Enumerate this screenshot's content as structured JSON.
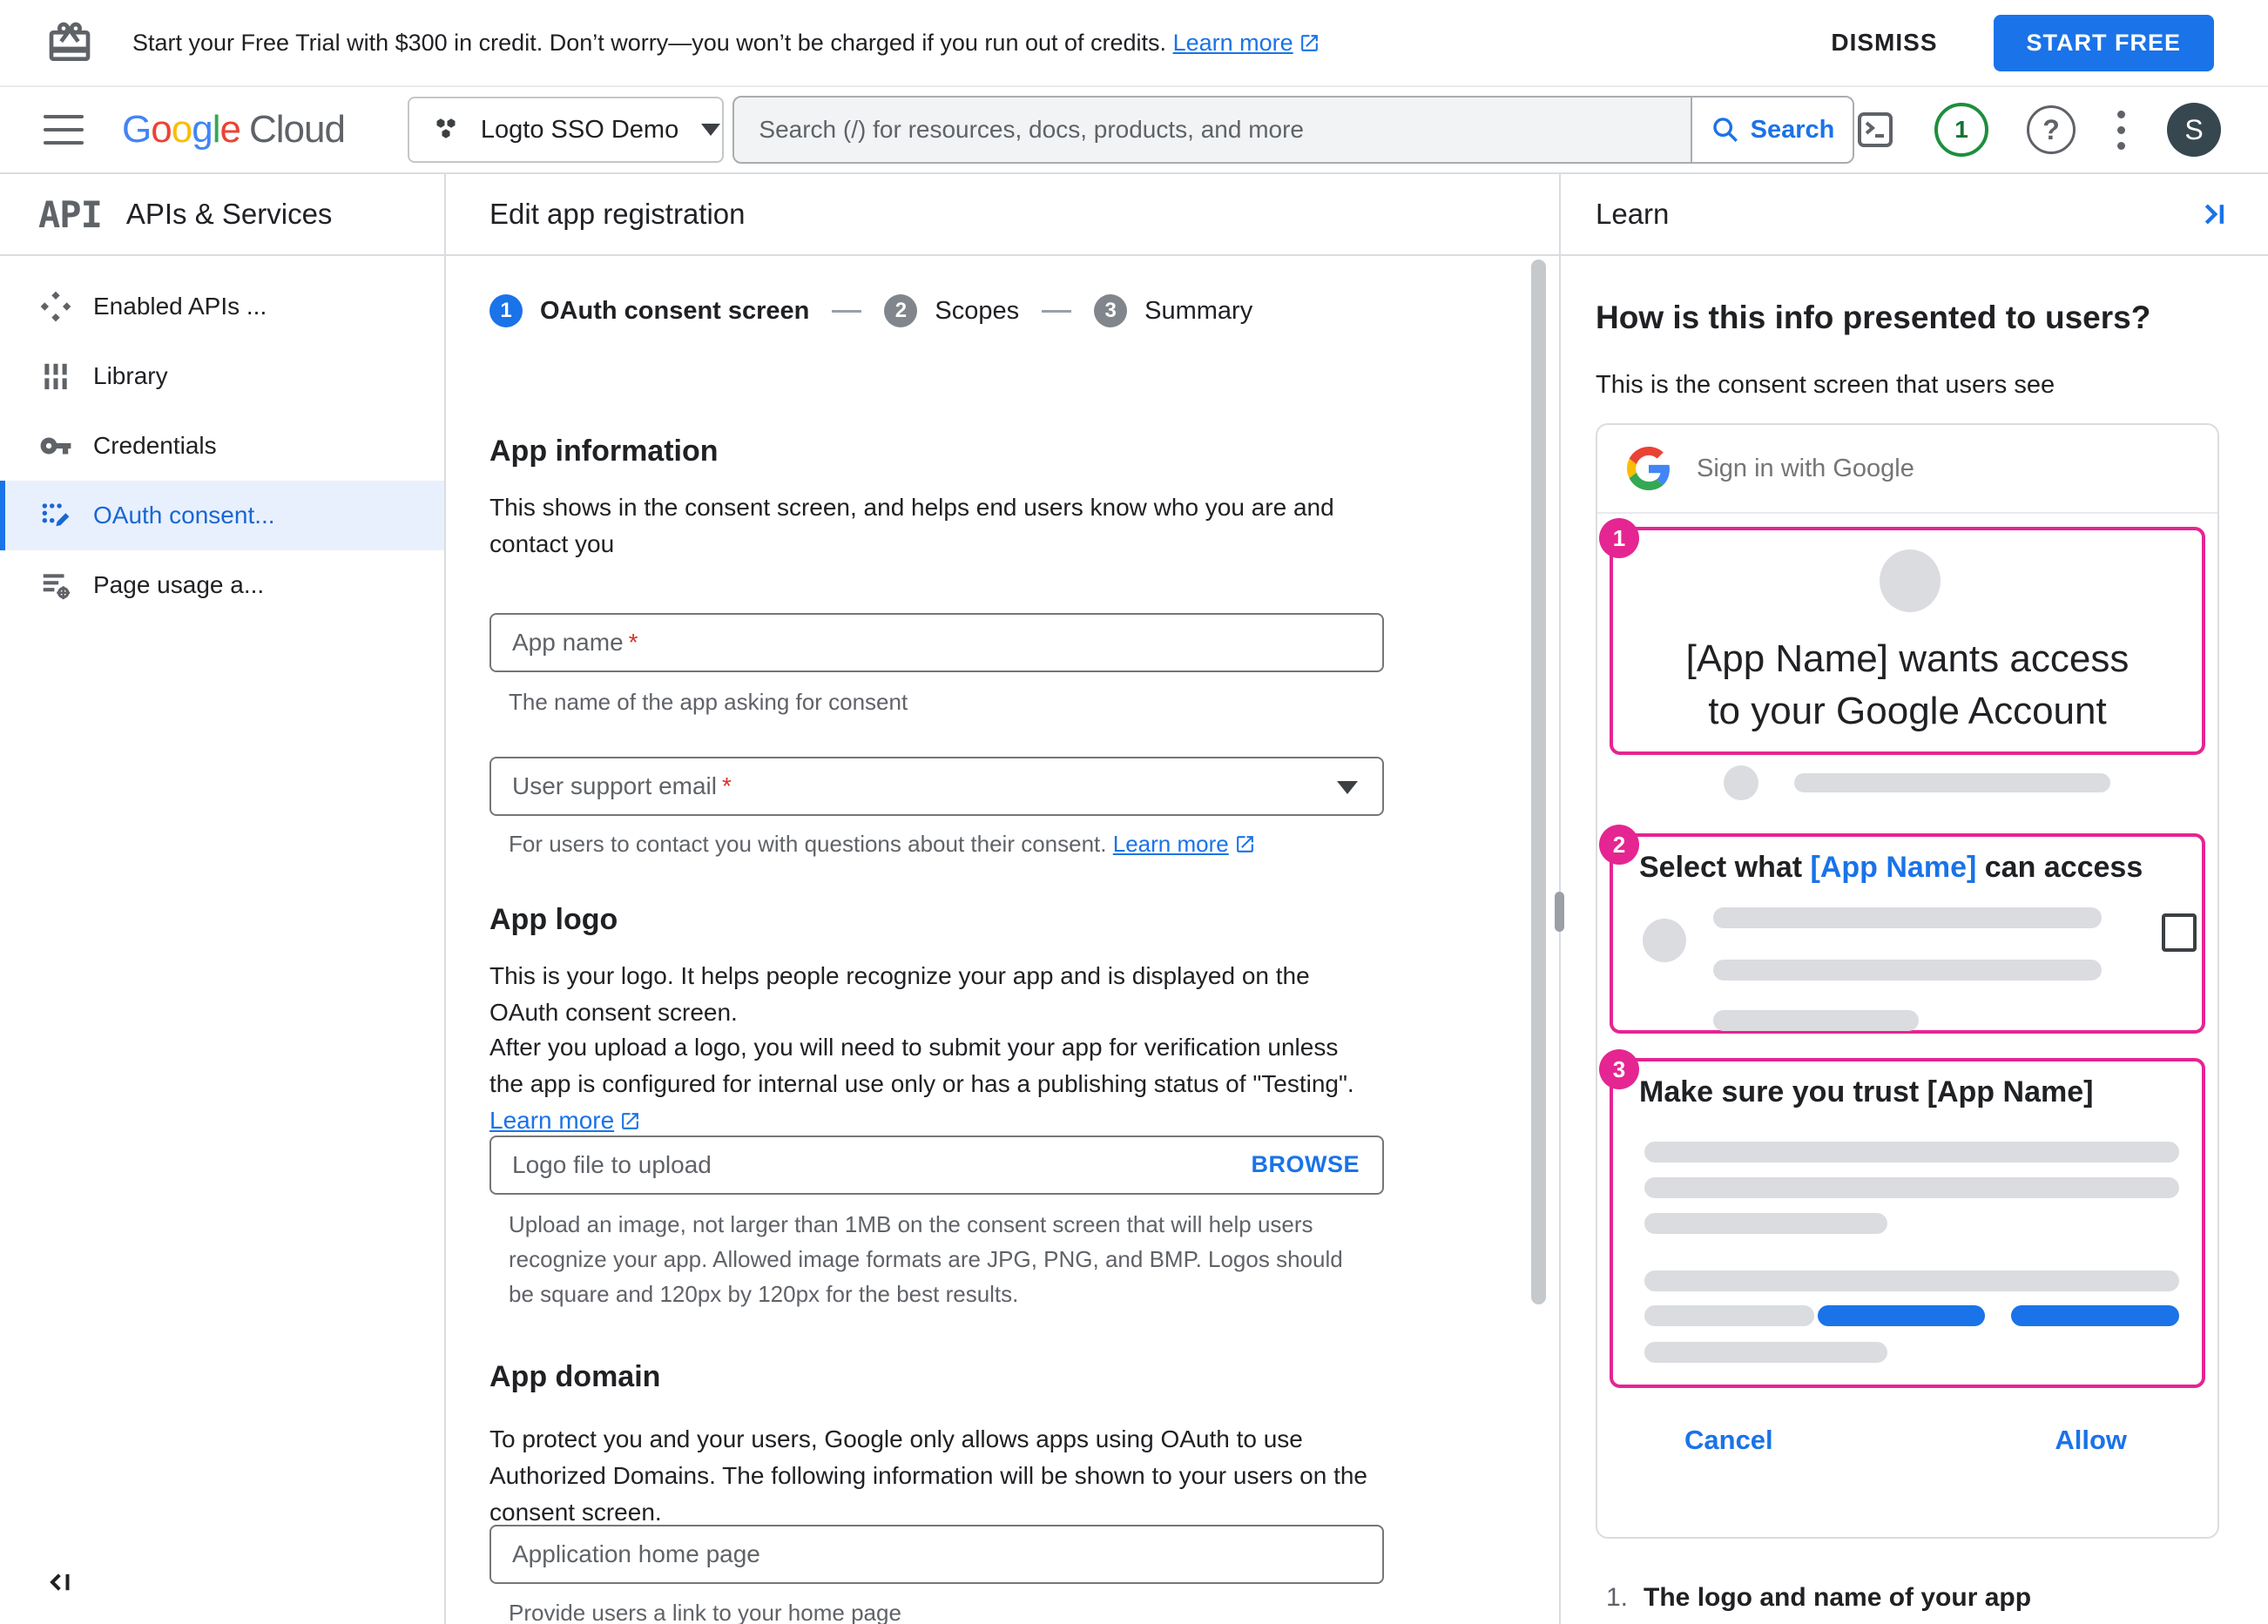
{
  "banner": {
    "message": "Start your Free Trial with $300 in credit. Don’t worry—you won’t be charged if you run out of credits.",
    "learn_more": "Learn more",
    "dismiss": "DISMISS",
    "start_free": "START FREE"
  },
  "header": {
    "logo_google": "Google",
    "logo_cloud": "Cloud",
    "project_name": "Logto SSO Demo",
    "search_placeholder": "Search (/) for resources, docs, products, and more",
    "search_button": "Search",
    "trial_days": "1",
    "avatar_initial": "S"
  },
  "sidebar": {
    "product_abbrev": "API",
    "title": "APIs & Services",
    "items": [
      {
        "label": "Enabled APIs ..."
      },
      {
        "label": "Library"
      },
      {
        "label": "Credentials"
      },
      {
        "label": "OAuth consent..."
      },
      {
        "label": "Page usage a..."
      }
    ]
  },
  "main": {
    "title": "Edit app registration",
    "stepper": [
      {
        "num": "1",
        "label": "OAuth consent screen"
      },
      {
        "num": "2",
        "label": "Scopes"
      },
      {
        "num": "3",
        "label": "Summary"
      }
    ],
    "app_information": {
      "heading": "App information",
      "description": "This shows in the consent screen, and helps end users know who you are and contact you",
      "app_name_label": "App name",
      "required_marker": "*",
      "app_name_helper": "The name of the app asking for consent",
      "email_label": "User support email",
      "email_helper": "For users to contact you with questions about their consent.",
      "email_learn_more": "Learn more"
    },
    "app_logo": {
      "heading": "App logo",
      "description_1": "This is your logo. It helps people recognize your app and is displayed on the OAuth consent screen.",
      "description_2": "After you upload a logo, you will need to submit your app for verification unless the app is configured for internal use only or has a publishing status of \"Testing\".",
      "learn_more": "Learn more",
      "upload_label": "Logo file to upload",
      "browse_button": "BROWSE",
      "upload_helper": "Upload an image, not larger than 1MB on the consent screen that will help users recognize your app. Allowed image formats are JPG, PNG, and BMP. Logos should be square and 120px by 120px for the best results."
    },
    "app_domain": {
      "heading": "App domain",
      "description": "To protect you and your users, Google only allows apps using OAuth to use Authorized Domains. The following information will be shown to your users on the consent screen.",
      "home_page_label": "Application home page",
      "home_page_helper": "Provide users a link to your home page"
    }
  },
  "learn": {
    "title": "Learn",
    "heading": "How is this info presented to users?",
    "subheading": "This is the consent screen that users see",
    "preview": {
      "signin_text": "Sign in with Google",
      "step1": {
        "badge": "1",
        "line1": "[App Name] wants access",
        "line2": "to your Google Account"
      },
      "step2": {
        "badge": "2",
        "title_pre": "Select what ",
        "title_app": "[App Name]",
        "title_post": " can access"
      },
      "step3": {
        "badge": "3",
        "title": "Make sure you trust [App Name]"
      },
      "cancel": "Cancel",
      "allow": "Allow"
    },
    "footnote": {
      "num": "1.",
      "text": "The logo and name of your app"
    }
  },
  "colors": {
    "accent_blue": "#1a73e8",
    "annotation_pink": "#e52592",
    "trial_green": "#1e8e3e",
    "google_letter_colors": [
      "#4285F4",
      "#EA4335",
      "#FBBC05",
      "#4285F4",
      "#34A853",
      "#EA4335"
    ]
  }
}
